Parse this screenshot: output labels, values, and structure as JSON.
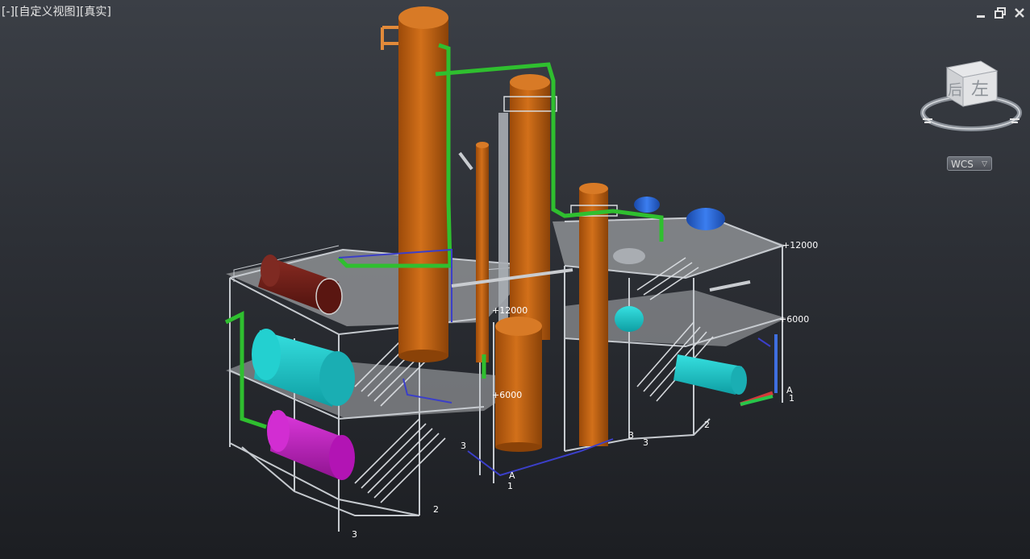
{
  "viewport": {
    "control_label": "[-]",
    "view_label": "[自定义视图]",
    "style_label": "[真实]"
  },
  "window_controls": {
    "minimize_icon": "minimize-icon",
    "restore_icon": "restore-icon",
    "close_icon": "close-icon"
  },
  "viewcube": {
    "face_back": "后",
    "face_left": "左"
  },
  "wcs": {
    "label": "WCS",
    "arrow": "▽"
  },
  "model_labels": {
    "elev_12000_left": "+12000",
    "elev_6000_left": "+6000",
    "elev_12000_right": "+12000",
    "elev_6000_right": "+6000",
    "grid_a_center": "A",
    "grid_1_center": "1",
    "grid_a_right": "A",
    "grid_1_right": "1",
    "grid_2_left": "2",
    "grid_3_left": "3",
    "grid_3_mid": "3",
    "grid_3_right": "3",
    "grid_2_right": "2",
    "grid_3_bottom": "3"
  },
  "colors": {
    "tower": "#c8650e",
    "tower_dark": "#8a4208",
    "steel": "#b9bec4",
    "deck": "#8d8f93",
    "pipe_green": "#2fbf2f",
    "pipe_blue": "#3b3fc9",
    "vessel_cyan": "#19c9c9",
    "vessel_magenta": "#c21bc6",
    "vessel_brown": "#6e1c17",
    "exchanger_blue": "#1f5fd1",
    "axis_red": "#d33a3a",
    "axis_green": "#27c64a",
    "axis_blue": "#3f6fe0"
  }
}
